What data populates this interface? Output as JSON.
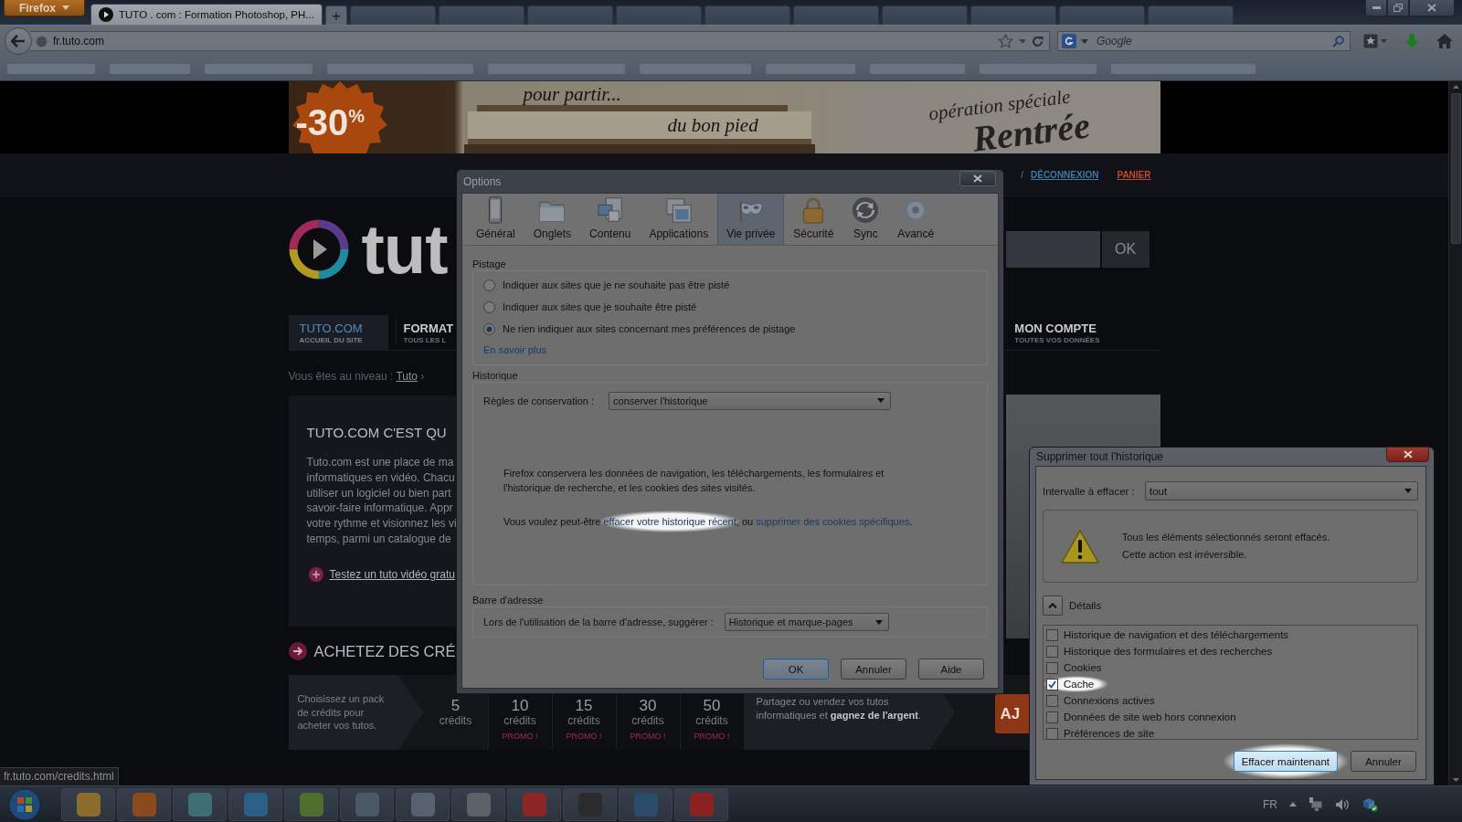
{
  "browser": {
    "menu_button": "Firefox",
    "tabs": [
      {
        "title": "TUTO . com : Formation Photoshop, PH...",
        "selected": true
      }
    ],
    "new_tab": "+",
    "address": "fr.tuto.com",
    "search_placeholder": "Google"
  },
  "banner": {
    "badge": "-30$^{%}$",
    "tagline_1": "pour partir...",
    "tagline_2": "du bon pied",
    "promo_1": "opération spéciale",
    "promo_2": "Rentrée"
  },
  "site": {
    "account_links": [
      {
        "label": "DÉCONNEXION",
        "kind": "account"
      },
      {
        "label": "PANIER",
        "kind": "cart"
      }
    ],
    "link_separator": "/",
    "logo_text": "tut",
    "search_button": "OK",
    "nav": [
      {
        "title": "TUTO.COM",
        "subtitle": "ACCUEIL DU SITE",
        "selected": true
      },
      {
        "title": "FORMAT",
        "subtitle": "TOUS LES L",
        "selected": false
      },
      {
        "title": "MON COMPTE",
        "subtitle": "TOUTES VOS DONNÉES",
        "selected": false
      }
    ],
    "breadcrumb": {
      "prefix": "Vous êtes au niveau :",
      "link": "Tuto",
      "suffix": "›"
    },
    "intro": {
      "heading": "TUTO.COM C'EST QU",
      "lines": [
        "Tuto.com est une place de ma",
        "informatiques en vidéo. Chacu",
        "utiliser un logiciel ou bien part",
        "savoir-faire informatique. Appr",
        "votre rythme et visionnez les vi",
        "temps, parmi un catalogue de"
      ],
      "link": "Testez un tuto vidéo gratu"
    },
    "credits": {
      "heading": "ACHETEZ DES CRÉ",
      "pitch": "Choisissez un pack de crédits pour acheter vos tutos.",
      "packs": [
        {
          "count": "5",
          "unit": "crédits"
        },
        {
          "count": "10",
          "unit": "crédits",
          "badge": "PROMO !"
        },
        {
          "count": "15",
          "unit": "crédits",
          "badge": "PROMO !"
        },
        {
          "count": "30",
          "unit": "crédits",
          "badge": "PROMO !"
        },
        {
          "count": "50",
          "unit": "crédits",
          "badge": "PROMO !"
        }
      ],
      "share": "Partagez ou vendez vos tutos informatiques et **gagnez de l'argent**.",
      "button": "AJ"
    }
  },
  "status_url": "fr.tuto.com/credits.html",
  "options_dialog": {
    "title": "Options",
    "panes": [
      {
        "label": "Général",
        "selected": false
      },
      {
        "label": "Onglets",
        "selected": false
      },
      {
        "label": "Contenu",
        "selected": false
      },
      {
        "label": "Applications",
        "selected": false
      },
      {
        "label": "Vie privée",
        "selected": true
      },
      {
        "label": "Sécurité",
        "selected": false
      },
      {
        "label": "Sync",
        "selected": false
      },
      {
        "label": "Avancé",
        "selected": false
      }
    ],
    "tracking": {
      "legend": "Pistage",
      "options": [
        {
          "label": "Indiquer aux sites que je ne souhaite pas être pisté",
          "selected": false
        },
        {
          "label": "Indiquer aux sites que je souhaite être pisté",
          "selected": false
        },
        {
          "label": "Ne rien indiquer aux sites concernant mes préférences de pistage",
          "selected": true
        }
      ],
      "link": "En savoir plus"
    },
    "history": {
      "legend": "Historique",
      "rule_label": "Règles de conservation :",
      "rule_value": "conserver l'historique",
      "description": "Firefox conservera les données de navigation, les téléchargements, les formulaires et l'historique de recherche, et les cookies des sites visités.",
      "suggestion_start": "Vous voulez peut-être ",
      "links": [
        {
          "text": "effacer votre historique récent",
          "highlighted": true
        },
        {
          "text": "supprimer des cookies spécifiques",
          "highlighted": false
        }
      ],
      "suggestion_join": ", ou ",
      "suggestion_end": "."
    },
    "address_bar": {
      "legend": "Barre d'adresse",
      "label": "Lors de l'utilisation de la barre d'adresse, suggérer :",
      "value": "Historique et marque-pages"
    },
    "buttons": [
      {
        "label": "OK",
        "default": true
      },
      {
        "label": "Annuler",
        "default": false
      },
      {
        "label": "Aide",
        "default": false
      }
    ]
  },
  "clear_dialog": {
    "title": "Supprimer tout l'historique",
    "range_label": "Intervalle à effacer :",
    "range_value": "tout",
    "warning": [
      "Tous les éléments sélectionnés seront effacés.",
      "Cette action est irréversible."
    ],
    "details_label": "Détails",
    "expanded": true,
    "items": [
      {
        "label": "Historique de navigation et des téléchargements",
        "checked": false,
        "highlighted": false
      },
      {
        "label": "Historique des formulaires et des recherches",
        "checked": false,
        "highlighted": false
      },
      {
        "label": "Cookies",
        "checked": false,
        "highlighted": false
      },
      {
        "label": "Cache",
        "checked": true,
        "highlighted": true
      },
      {
        "label": "Connexions actives",
        "checked": false,
        "highlighted": false
      },
      {
        "label": "Données de site web hors connexion",
        "checked": false,
        "highlighted": false
      },
      {
        "label": "Préférences de site",
        "checked": false,
        "highlighted": false
      }
    ],
    "buttons": [
      {
        "label": "Effacer maintenant",
        "default": true,
        "highlighted": true
      },
      {
        "label": "Annuler",
        "default": false,
        "highlighted": false
      }
    ]
  },
  "taskbar": {
    "language": "FR"
  }
}
